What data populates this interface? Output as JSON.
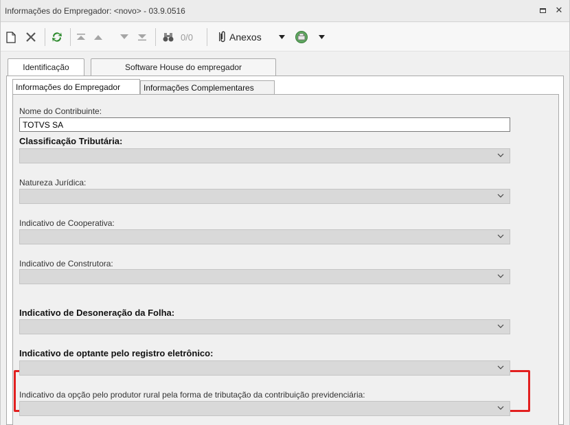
{
  "window": {
    "title": "Informações do Empregador: <novo> - 03.9.0516"
  },
  "toolbar": {
    "counter": "0/0",
    "attachments_label": "Anexos"
  },
  "outer_tabs": [
    {
      "label": "Identificação",
      "active": true
    },
    {
      "label": "Software House do empregador",
      "active": false
    }
  ],
  "inner_tabs": [
    {
      "label": "Informações do Empregador",
      "active": true
    },
    {
      "label": "Informações Complementares",
      "active": false
    }
  ],
  "form": {
    "contribuinte_label": "Nome do Contribuinte:",
    "contribuinte_value": "TOTVS SA",
    "classificacao_label": "Classificação Tributária:",
    "classificacao_value": "",
    "natureza_label": "Natureza Jurídica:",
    "natureza_value": "",
    "cooperativa_label": "Indicativo de Cooperativa:",
    "cooperativa_value": "",
    "construtora_label": "Indicativo de Construtora:",
    "construtora_value": "",
    "desoneracao_label": "Indicativo de Desoneração da Folha:",
    "desoneracao_value": "",
    "registro_label": "Indicativo de optante pelo registro eletrônico:",
    "registro_value": "",
    "produtor_label": "Indicativo da opção pelo produtor rural pela forma de tributação da contribuição previdenciária:",
    "produtor_value": ""
  },
  "colors": {
    "highlight": "#e21f1f",
    "refresh_icon": "#2e8b2e"
  }
}
